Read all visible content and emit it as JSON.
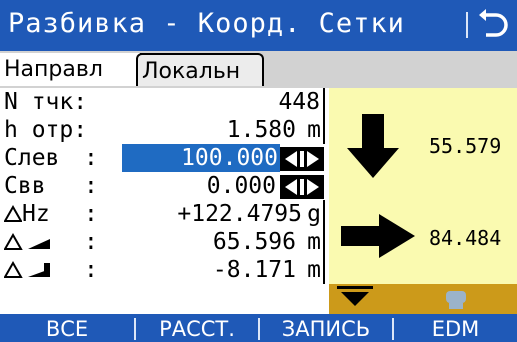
{
  "title": "Разбивка - Коорд. Сетки",
  "back_icon": "return-arrow-icon",
  "tabs": [
    {
      "label": "Направл",
      "active": true
    },
    {
      "label": "Локальн",
      "active": false
    }
  ],
  "fields": {
    "point": {
      "label": "N тчк",
      "value": "448"
    },
    "target_height": {
      "label": "h отр",
      "value": "1.580",
      "unit": "m"
    },
    "offset_left": {
      "label": "Слев",
      "value": "100.000"
    },
    "offset_right": {
      "label": "Свв",
      "value": "0.000"
    },
    "delta_hz": {
      "label": "Hz",
      "value": "+122.4795",
      "unit": "g"
    },
    "delta_dist": {
      "label": "",
      "value": "65.596",
      "unit": "m"
    },
    "delta_height": {
      "label": "",
      "value": "-8.171",
      "unit": "m"
    }
  },
  "graphic": {
    "down_value": "55.579",
    "right_value": "84.484"
  },
  "softkeys": [
    "ВСЕ",
    "РАССТ.",
    "ЗАПИСЬ",
    "EDM"
  ],
  "colors": {
    "header_blue": "#1f59b7",
    "selected_field": "#1f6bc2",
    "graphic_bg": "#fafab0",
    "ground_band": "#cc9a1a"
  }
}
